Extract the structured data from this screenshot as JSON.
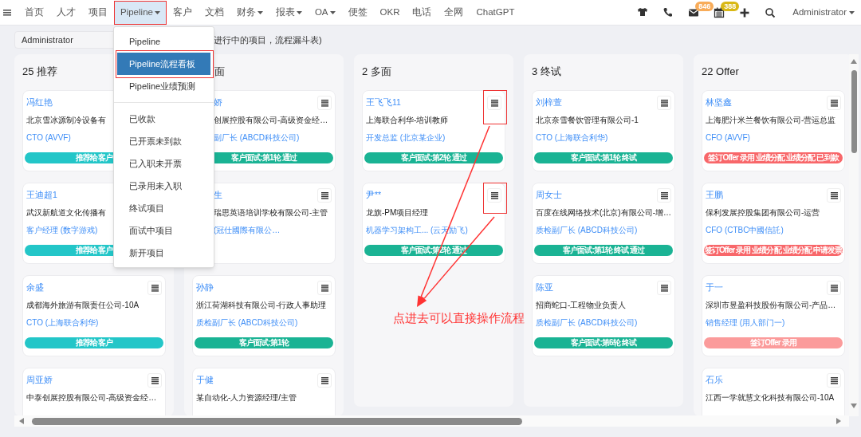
{
  "nav": {
    "items": [
      {
        "label": "首页",
        "selected": false,
        "caret": false
      },
      {
        "label": "人才",
        "selected": false,
        "caret": false
      },
      {
        "label": "项目",
        "selected": false,
        "caret": false
      },
      {
        "label": "Pipeline",
        "selected": true,
        "caret": true
      },
      {
        "label": "客户",
        "selected": false,
        "caret": false
      },
      {
        "label": "文档",
        "selected": false,
        "caret": false
      },
      {
        "label": "财务",
        "selected": false,
        "caret": true
      },
      {
        "label": "报表",
        "selected": false,
        "caret": true
      },
      {
        "label": "OA",
        "selected": false,
        "caret": true
      },
      {
        "label": "便签",
        "selected": false,
        "caret": false
      },
      {
        "label": "OKR",
        "selected": false,
        "caret": false
      },
      {
        "label": "电话",
        "selected": false,
        "caret": false
      },
      {
        "label": "全网",
        "selected": false,
        "caret": false
      },
      {
        "label": "ChatGPT",
        "selected": false,
        "caret": false
      }
    ],
    "tools": [
      {
        "kind": "shirt"
      },
      {
        "kind": "phone"
      },
      {
        "kind": "mail",
        "badge": "846",
        "color": "#f8ac59"
      },
      {
        "kind": "calendar",
        "badge": "388",
        "color": "#d9b814"
      },
      {
        "kind": "plus"
      },
      {
        "kind": "search"
      }
    ],
    "user": "Administrator"
  },
  "filter": {
    "select": "Administrator",
    "note": "进行中的项目，流程漏斗表)"
  },
  "dropdown": {
    "groups": [
      [
        {
          "label": "Pipeline",
          "selected": false
        },
        {
          "label": "Pipeline流程看板",
          "selected": true
        },
        {
          "label": "Pipeline业绩预测",
          "selected": false
        }
      ],
      [
        {
          "label": "已收款",
          "selected": false
        },
        {
          "label": "已开票未到款",
          "selected": false
        },
        {
          "label": "已入职未开票",
          "selected": false
        },
        {
          "label": "已录用未入职",
          "selected": false
        },
        {
          "label": "终试项目",
          "selected": false
        },
        {
          "label": "面试中项目",
          "selected": false
        },
        {
          "label": "新开项目",
          "selected": false
        }
      ]
    ]
  },
  "columns": [
    {
      "title": "25 推荐",
      "partly_hidden": false,
      "cards": [
        {
          "name": "冯红艳",
          "company": "北京雪冰源制冷设备有",
          "position": "CTO (AVVF)",
          "status": "推荐给客户",
          "color": "#23c6c8",
          "menu_button": false,
          "partly_hidden": false
        },
        {
          "name": "王迪超1",
          "company": "武汉新航道文化传播有",
          "position": "客户经理 (数字游戏)",
          "status": "推荐给客户",
          "color": "#23c6c8",
          "menu_button": false,
          "partly_hidden": false
        },
        {
          "name": "余盛",
          "company": "成都海外旅游有限责任公司-10A",
          "position": "CTO (上海联合利华)",
          "status": "推荐给客户",
          "color": "#23c6c8",
          "menu_button": true,
          "partly_hidden": false
        },
        {
          "name": "周亚娇",
          "company": "中泰创展控股有限公司-高级资金经…",
          "menu_button": true,
          "partly_hidden": false
        }
      ]
    },
    {
      "title": "面",
      "partly_hidden": true,
      "cards": [
        {
          "name": "娇",
          "company": "创展控股有限公司-高级资金经…",
          "position": "副厂长 (ABCD科技公司)",
          "status": "客户面试:第1轮 通过",
          "color": "#1ab394",
          "menu_button": true,
          "partly_hidden": true
        },
        {
          "name": "生",
          "company": "瑞思英语培训学校有限公司-主管",
          "position": "(冠仕國際有限公…",
          "menu_button": true,
          "partly_hidden": true
        },
        {
          "name": "孙静",
          "company": "浙江荷湖科技有限公司-行政人事助理",
          "position": "质检副厂长 (ABCD科技公司)",
          "status": "客户面试:第1轮",
          "color": "#1ab394",
          "menu_button": true,
          "partly_hidden": false
        },
        {
          "name": "于健",
          "company": "某自动化-人力资源经理/主管",
          "menu_button": true,
          "partly_hidden": false
        }
      ]
    },
    {
      "title": "2 多面",
      "partly_hidden": false,
      "cards": [
        {
          "name": "王飞飞11",
          "company": "上海联合利华-培训教师",
          "position": "开发总监 (北京某企业)",
          "status": "客户面试:第2轮 通过",
          "color": "#1ab394",
          "menu_button": true,
          "partly_hidden": false
        },
        {
          "name": "尹**",
          "company": "龙旗-PM项目经理",
          "position": "机器学习架构工...  (云天励飞)",
          "status": "客户面试:第2轮 通过",
          "color": "#1ab394",
          "menu_button": true,
          "partly_hidden": false
        }
      ]
    },
    {
      "title": "3 终试",
      "partly_hidden": false,
      "cards": [
        {
          "name": "刘梓萱",
          "company": "北京奈雪餐饮管理有限公司-1",
          "position": "CTO (上海联合利华)",
          "status": "客户面试:第1轮 终试",
          "color": "#1ab394",
          "menu_button": true,
          "partly_hidden": false
        },
        {
          "name": "周女士",
          "company": "百度在线网络技术(北京)有限公司-增…",
          "position": "质检副厂长 (ABCD科技公司)",
          "status": "客户面试:第1轮 终试 通过",
          "color": "#1ab394",
          "menu_button": true,
          "partly_hidden": false
        },
        {
          "name": "陈亚",
          "company": "招商蛇口-工程物业负责人",
          "position": "质检副厂长 (ABCD科技公司)",
          "status": "客户面试:第6轮 终试",
          "color": "#1ab394",
          "menu_button": true,
          "partly_hidden": false
        }
      ]
    },
    {
      "title": "22 Offer",
      "partly_hidden": false,
      "cards": [
        {
          "name": "林坚鑫",
          "company": "上海肥汁米兰餐饮有限公司-营运总监",
          "position": "CFO (AVVF)",
          "status": "签订Offer 录用 业绩分配 业绩分配 已到款",
          "color": "#f8676a",
          "menu_button": true,
          "partly_hidden": false
        },
        {
          "name": "王鹏",
          "company": "保利发展控股集团有限公司-运营",
          "position": "CFO (CTBC中國信託)",
          "status": "签订Offer 录用 业绩分配 业绩分配 申请发票",
          "color": "#f8676a",
          "menu_button": true,
          "partly_hidden": false
        },
        {
          "name": "于一",
          "company": "深圳市昱盈科技股份有限公司-产品…",
          "position": "销售经理 (用人部门一)",
          "status": "签订Offer 录用",
          "color": "#fb9b9b",
          "menu_button": true,
          "partly_hidden": false
        },
        {
          "name": "石乐",
          "company": "江西一学就慧文化科技有限公司-10A",
          "menu_button": true,
          "partly_hidden": false
        }
      ]
    }
  ],
  "annotation": {
    "text": "点进去可以直接操作流程"
  }
}
